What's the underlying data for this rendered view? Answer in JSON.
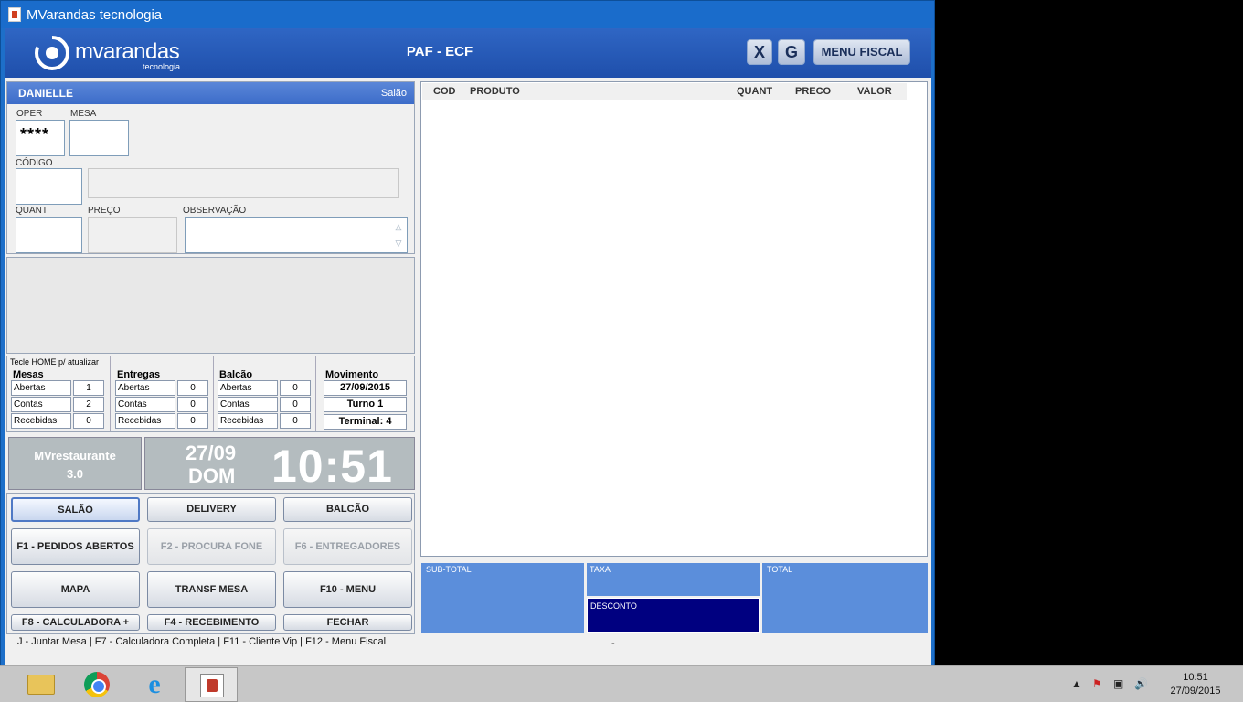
{
  "window": {
    "title": "MVarandas tecnologia"
  },
  "header": {
    "logo_word": "mvarandas",
    "logo_sub": "tecnologia",
    "app_name": "PAF - ECF",
    "btn_x": "X",
    "btn_g": "G",
    "btn_menu_fiscal": "MENU FISCAL"
  },
  "order": {
    "customer": "DANIELLE",
    "section": "Salão",
    "oper_label": "OPER",
    "oper_value": "****",
    "mesa_label": "MESA",
    "mesa_value": "",
    "codigo_label": "CÓDIGO",
    "quant_label": "QUANT",
    "preco_label": "PREÇO",
    "obs_label": "OBSERVAÇÃO"
  },
  "stats": {
    "hint": "Tecle HOME  p/ atualizar",
    "mesas": {
      "title": "Mesas",
      "rows": [
        {
          "label": "Abertas",
          "value": "1"
        },
        {
          "label": "Contas",
          "value": "2"
        },
        {
          "label": "Recebidas",
          "value": "0"
        }
      ]
    },
    "entregas": {
      "title": "Entregas",
      "rows": [
        {
          "label": "Abertas",
          "value": "0"
        },
        {
          "label": "Contas",
          "value": "0"
        },
        {
          "label": "Recebidas",
          "value": "0"
        }
      ]
    },
    "balcao": {
      "title": "Balcão",
      "rows": [
        {
          "label": "Abertas",
          "value": "0"
        },
        {
          "label": "Contas",
          "value": "0"
        },
        {
          "label": "Recebidas",
          "value": "0"
        }
      ]
    },
    "movimento": {
      "title": "Movimento",
      "date": "27/09/2015",
      "turno": "Turno 1",
      "terminal": "Terminal: 4"
    }
  },
  "brand": {
    "name": "MVrestaurante",
    "version": "3.0"
  },
  "clock": {
    "date": "27/09",
    "dow": "DOM",
    "time": "10:51"
  },
  "buttons": {
    "salao": "SALÃO",
    "delivery": "DELIVERY",
    "balcao": "BALCÃO",
    "f1": "F1 - PEDIDOS ABERTOS",
    "f2": "F2 - PROCURA FONE",
    "f6": "F6 - ENTREGADORES",
    "mapa": "MAPA",
    "transf": "TRANSF MESA",
    "f10": "F10 - MENU",
    "f8": "F8 - CALCULADORA +",
    "f4": "F4 - RECEBIMENTO",
    "fechar": "FECHAR"
  },
  "shortcuts": "J - Juntar Mesa  |  F7 - Calculadora  Completa  |  F11 - Cliente Vip  |  F12 - Menu Fiscal",
  "grid": {
    "columns": [
      "COD",
      "PRODUTO",
      "QUANT",
      "PRECO",
      "VALOR"
    ],
    "rows": []
  },
  "totals": {
    "subtotal": "SUB-TOTAL",
    "taxa": "TAXA",
    "desconto": "DESCONTO",
    "total": "TOTAL",
    "dash": "-"
  },
  "taskbar": {
    "time": "10:51",
    "date": "27/09/2015"
  },
  "colors": {
    "header_blue": "#1f4fab",
    "totals_blue": "#5b8edb",
    "desconto_navy": "#000080",
    "clock_gray": "#b4bcbf"
  }
}
